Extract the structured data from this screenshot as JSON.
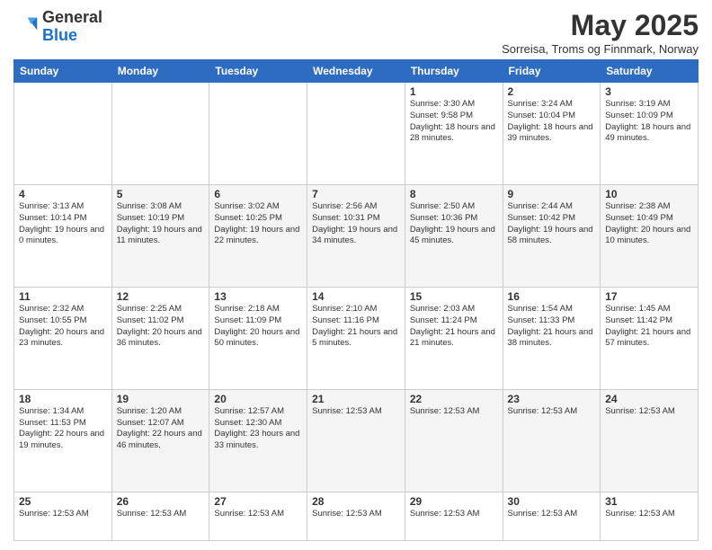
{
  "logo": {
    "general": "General",
    "blue": "Blue"
  },
  "title": "May 2025",
  "subtitle": "Sorreisa, Troms og Finnmark, Norway",
  "headers": [
    "Sunday",
    "Monday",
    "Tuesday",
    "Wednesday",
    "Thursday",
    "Friday",
    "Saturday"
  ],
  "weeks": [
    {
      "days": [
        {
          "num": "",
          "info": ""
        },
        {
          "num": "",
          "info": ""
        },
        {
          "num": "",
          "info": ""
        },
        {
          "num": "",
          "info": ""
        },
        {
          "num": "1",
          "info": "Sunrise: 3:30 AM\nSunset: 9:58 PM\nDaylight: 18 hours\nand 28 minutes."
        },
        {
          "num": "2",
          "info": "Sunrise: 3:24 AM\nSunset: 10:04 PM\nDaylight: 18 hours\nand 39 minutes."
        },
        {
          "num": "3",
          "info": "Sunrise: 3:19 AM\nSunset: 10:09 PM\nDaylight: 18 hours\nand 49 minutes."
        }
      ]
    },
    {
      "days": [
        {
          "num": "4",
          "info": "Sunrise: 3:13 AM\nSunset: 10:14 PM\nDaylight: 19 hours\nand 0 minutes."
        },
        {
          "num": "5",
          "info": "Sunrise: 3:08 AM\nSunset: 10:19 PM\nDaylight: 19 hours\nand 11 minutes."
        },
        {
          "num": "6",
          "info": "Sunrise: 3:02 AM\nSunset: 10:25 PM\nDaylight: 19 hours\nand 22 minutes."
        },
        {
          "num": "7",
          "info": "Sunrise: 2:56 AM\nSunset: 10:31 PM\nDaylight: 19 hours\nand 34 minutes."
        },
        {
          "num": "8",
          "info": "Sunrise: 2:50 AM\nSunset: 10:36 PM\nDaylight: 19 hours\nand 45 minutes."
        },
        {
          "num": "9",
          "info": "Sunrise: 2:44 AM\nSunset: 10:42 PM\nDaylight: 19 hours\nand 58 minutes."
        },
        {
          "num": "10",
          "info": "Sunrise: 2:38 AM\nSunset: 10:49 PM\nDaylight: 20 hours\nand 10 minutes."
        }
      ]
    },
    {
      "days": [
        {
          "num": "11",
          "info": "Sunrise: 2:32 AM\nSunset: 10:55 PM\nDaylight: 20 hours\nand 23 minutes."
        },
        {
          "num": "12",
          "info": "Sunrise: 2:25 AM\nSunset: 11:02 PM\nDaylight: 20 hours\nand 36 minutes."
        },
        {
          "num": "13",
          "info": "Sunrise: 2:18 AM\nSunset: 11:09 PM\nDaylight: 20 hours\nand 50 minutes."
        },
        {
          "num": "14",
          "info": "Sunrise: 2:10 AM\nSunset: 11:16 PM\nDaylight: 21 hours\nand 5 minutes."
        },
        {
          "num": "15",
          "info": "Sunrise: 2:03 AM\nSunset: 11:24 PM\nDaylight: 21 hours\nand 21 minutes."
        },
        {
          "num": "16",
          "info": "Sunrise: 1:54 AM\nSunset: 11:33 PM\nDaylight: 21 hours\nand 38 minutes."
        },
        {
          "num": "17",
          "info": "Sunrise: 1:45 AM\nSunset: 11:42 PM\nDaylight: 21 hours\nand 57 minutes."
        }
      ]
    },
    {
      "days": [
        {
          "num": "18",
          "info": "Sunrise: 1:34 AM\nSunset: 11:53 PM\nDaylight: 22 hours\nand 19 minutes."
        },
        {
          "num": "19",
          "info": "Sunrise: 1:20 AM\nSunset: 12:07 AM\nDaylight: 22 hours\nand 46 minutes."
        },
        {
          "num": "20",
          "info": "Sunrise: 12:57 AM\nSunset: 12:30 AM\nDaylight: 23 hours\nand 33 minutes."
        },
        {
          "num": "21",
          "info": "Sunrise: 12:53 AM"
        },
        {
          "num": "22",
          "info": "Sunrise: 12:53 AM"
        },
        {
          "num": "23",
          "info": "Sunrise: 12:53 AM"
        },
        {
          "num": "24",
          "info": "Sunrise: 12:53 AM"
        }
      ]
    },
    {
      "days": [
        {
          "num": "25",
          "info": "Sunrise: 12:53 AM"
        },
        {
          "num": "26",
          "info": "Sunrise: 12:53 AM"
        },
        {
          "num": "27",
          "info": "Sunrise: 12:53 AM"
        },
        {
          "num": "28",
          "info": "Sunrise: 12:53 AM"
        },
        {
          "num": "29",
          "info": "Sunrise: 12:53 AM"
        },
        {
          "num": "30",
          "info": "Sunrise: 12:53 AM"
        },
        {
          "num": "31",
          "info": "Sunrise: 12:53 AM"
        }
      ]
    }
  ]
}
